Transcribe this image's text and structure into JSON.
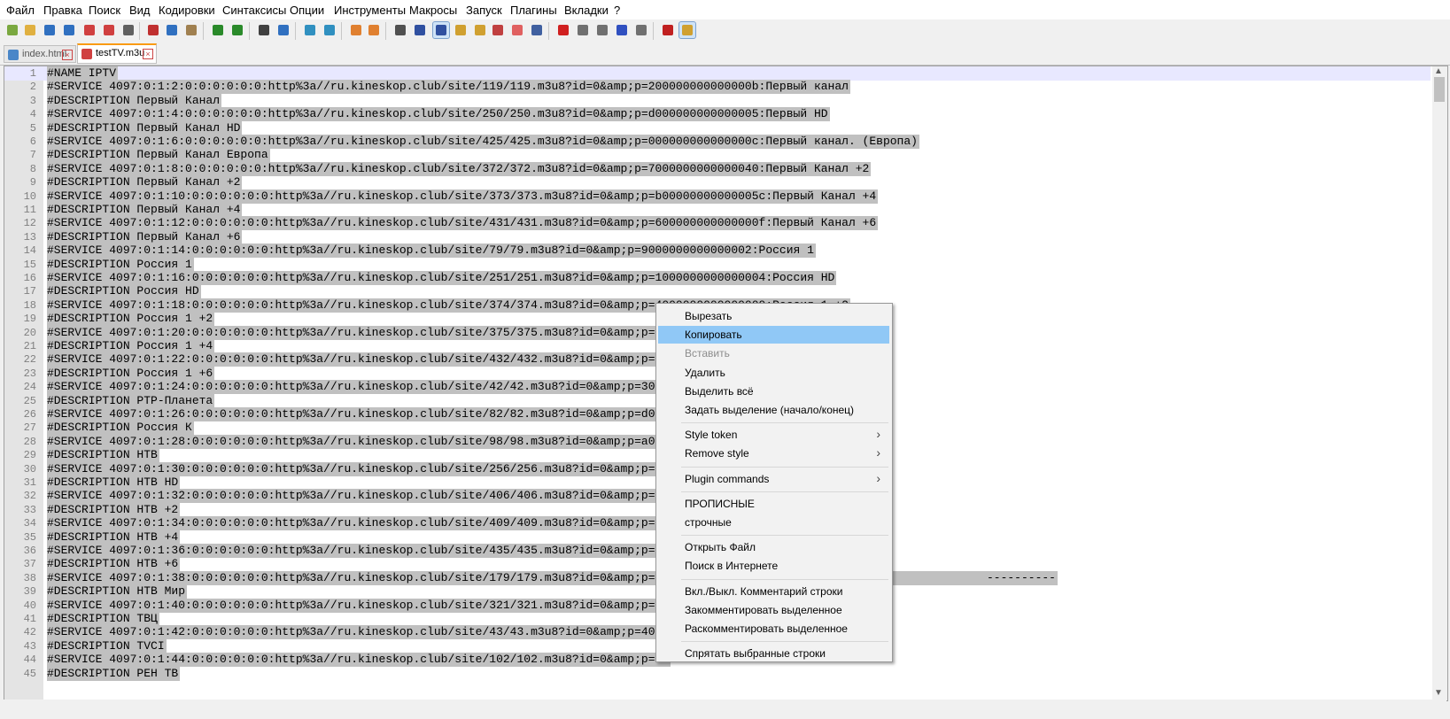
{
  "menubar": [
    "Файл",
    "Правка",
    "Поиск",
    "Вид",
    "Кодировки",
    "Синтаксисы",
    "Опции",
    "Инструменты",
    "Макросы",
    "Запуск",
    "Плагины",
    "Вкладки",
    "?"
  ],
  "toolbar": {
    "icons": [
      "new-file-icon",
      "open-file-icon",
      "save-icon",
      "save-all-icon",
      "close-icon",
      "close-all-icon",
      "print-icon",
      "cut-icon",
      "copy-icon",
      "paste-icon",
      "undo-icon",
      "redo-icon",
      "find-icon",
      "replace-icon",
      "zoom-in-icon",
      "zoom-out-icon",
      "sync-vertical-icon",
      "sync-horizontal-icon",
      "word-wrap-icon",
      "show-all-chars-icon",
      "indent-guide-icon",
      "udl-icon",
      "doc-map-icon",
      "function-list-icon",
      "folder-workspace-icon",
      "monitoring-icon",
      "record-macro-icon",
      "stop-macro-icon",
      "play-macro-icon",
      "run-macro-multiple-icon",
      "save-macro-icon",
      "spell-check-icon",
      "spell-check-auto-icon"
    ],
    "active": [
      "indent-guide-icon",
      "spell-check-auto-icon"
    ]
  },
  "tabs": [
    {
      "label": "index.html",
      "active": false,
      "color": "#4a86c8"
    },
    {
      "label": "testTV.m3u",
      "active": true,
      "color": "#d04040"
    }
  ],
  "editor": {
    "lines": [
      "#NAME IPTV",
      "#SERVICE 4097:0:1:2:0:0:0:0:0:0:http%3a//ru.kineskop.club/site/119/119.m3u8?id=0&amp;p=200000000000000b:Первый канал",
      "#DESCRIPTION Первый Канал",
      "#SERVICE 4097:0:1:4:0:0:0:0:0:0:http%3a//ru.kineskop.club/site/250/250.m3u8?id=0&amp;p=d000000000000005:Первый HD",
      "#DESCRIPTION Первый Канал HD",
      "#SERVICE 4097:0:1:6:0:0:0:0:0:0:http%3a//ru.kineskop.club/site/425/425.m3u8?id=0&amp;p=000000000000000c:Первый канал. (Европа)",
      "#DESCRIPTION Первый Канал Европа",
      "#SERVICE 4097:0:1:8:0:0:0:0:0:0:http%3a//ru.kineskop.club/site/372/372.m3u8?id=0&amp;p=7000000000000040:Первый Канал +2",
      "#DESCRIPTION Первый Канал +2",
      "#SERVICE 4097:0:1:10:0:0:0:0:0:0:http%3a//ru.kineskop.club/site/373/373.m3u8?id=0&amp;p=b00000000000005c:Первый Канал +4",
      "#DESCRIPTION Первый Канал +4",
      "#SERVICE 4097:0:1:12:0:0:0:0:0:0:http%3a//ru.kineskop.club/site/431/431.m3u8?id=0&amp;p=600000000000000f:Первый Канал +6",
      "#DESCRIPTION Первый Канал +6",
      "#SERVICE 4097:0:1:14:0:0:0:0:0:0:http%3a//ru.kineskop.club/site/79/79.m3u8?id=0&amp;p=9000000000000002:Россия 1",
      "#DESCRIPTION Россия 1",
      "#SERVICE 4097:0:1:16:0:0:0:0:0:0:http%3a//ru.kineskop.club/site/251/251.m3u8?id=0&amp;p=1000000000000004:Россия HD",
      "#DESCRIPTION Россия HD",
      "#SERVICE 4097:0:1:18:0:0:0:0:0:0:http%3a//ru.kineskop.club/site/374/374.m3u8?id=0&amp;p=4000000000000009:Россия 1 +2",
      "#DESCRIPTION Россия 1 +2",
      "#SERVICE 4097:0:1:20:0:0:0:0:0:0:http%3a//ru.kineskop.club/site/375/375.m3u8?id=0&amp;p=f0",
      "#DESCRIPTION Россия 1 +4",
      "#SERVICE 4097:0:1:22:0:0:0:0:0:0:http%3a//ru.kineskop.club/site/432/432.m3u8?id=0&amp;p=50",
      "#DESCRIPTION Россия 1 +6",
      "#SERVICE 4097:0:1:24:0:0:0:0:0:0:http%3a//ru.kineskop.club/site/42/42.m3u8?id=0&amp;p=3000",
      "#DESCRIPTION РТР-Планета",
      "#SERVICE 4097:0:1:26:0:0:0:0:0:0:http%3a//ru.kineskop.club/site/82/82.m3u8?id=0&amp;p=d000",
      "#DESCRIPTION Россия К",
      "#SERVICE 4097:0:1:28:0:0:0:0:0:0:http%3a//ru.kineskop.club/site/98/98.m3u8?id=0&amp;p=a000",
      "#DESCRIPTION НТВ",
      "#SERVICE 4097:0:1:30:0:0:0:0:0:0:http%3a//ru.kineskop.club/site/256/256.m3u8?id=0&amp;p=90",
      "#DESCRIPTION НТВ HD",
      "#SERVICE 4097:0:1:32:0:0:0:0:0:0:http%3a//ru.kineskop.club/site/406/406.m3u8?id=0&amp;p=10",
      "#DESCRIPTION НТВ +2",
      "#SERVICE 4097:0:1:34:0:0:0:0:0:0:http%3a//ru.kineskop.club/site/409/409.m3u8?id=0&amp;p=90",
      "#DESCRIPTION НТВ +4",
      "#SERVICE 4097:0:1:36:0:0:0:0:0:0:http%3a//ru.kineskop.club/site/435/435.m3u8?id=0&amp;p=d0",
      "#DESCRIPTION НТВ +6",
      "#SERVICE 4097:0:1:38:0:0:0:0:0:0:http%3a//ru.kineskop.club/site/179/179.m3u8?id=0&amp;p=00                                              ----------",
      "#DESCRIPTION НТВ Мир",
      "#SERVICE 4097:0:1:40:0:0:0:0:0:0:http%3a//ru.kineskop.club/site/321/321.m3u8?id=0&amp;p=70",
      "#DESCRIPTION ТВЦ",
      "#SERVICE 4097:0:1:42:0:0:0:0:0:0:http%3a//ru.kineskop.club/site/43/43.m3u8?id=0&amp;p=4000",
      "#DESCRIPTION TVCI",
      "#SERVICE 4097:0:1:44:0:0:0:0:0:0:http%3a//ru.kineskop.club/site/102/102.m3u8?id=0&amp;p=00",
      "#DESCRIPTION РЕН ТВ"
    ]
  },
  "context_menu": {
    "groups": [
      [
        {
          "label": "Вырезать",
          "state": "normal"
        },
        {
          "label": "Копировать",
          "state": "highlighted"
        },
        {
          "label": "Вставить",
          "state": "disabled"
        },
        {
          "label": "Удалить",
          "state": "normal"
        },
        {
          "label": "Выделить всё",
          "state": "normal"
        },
        {
          "label": "Задать выделение (начало/конец)",
          "state": "normal"
        }
      ],
      [
        {
          "label": "Style token",
          "state": "normal",
          "submenu": true
        },
        {
          "label": "Remove style",
          "state": "normal",
          "submenu": true
        }
      ],
      [
        {
          "label": "Plugin commands",
          "state": "normal",
          "submenu": true
        }
      ],
      [
        {
          "label": "ПРОПИСНЫЕ",
          "state": "normal"
        },
        {
          "label": "строчные",
          "state": "normal"
        }
      ],
      [
        {
          "label": "Открыть Файл",
          "state": "normal"
        },
        {
          "label": "Поиск в Интернете",
          "state": "normal"
        }
      ],
      [
        {
          "label": "Вкл./Выкл. Комментарий строки",
          "state": "normal"
        },
        {
          "label": "Закомментировать выделенное",
          "state": "normal"
        },
        {
          "label": "Раскомментировать выделенное",
          "state": "normal"
        }
      ],
      [
        {
          "label": "Спрятать выбранные строки",
          "state": "normal"
        }
      ]
    ]
  }
}
